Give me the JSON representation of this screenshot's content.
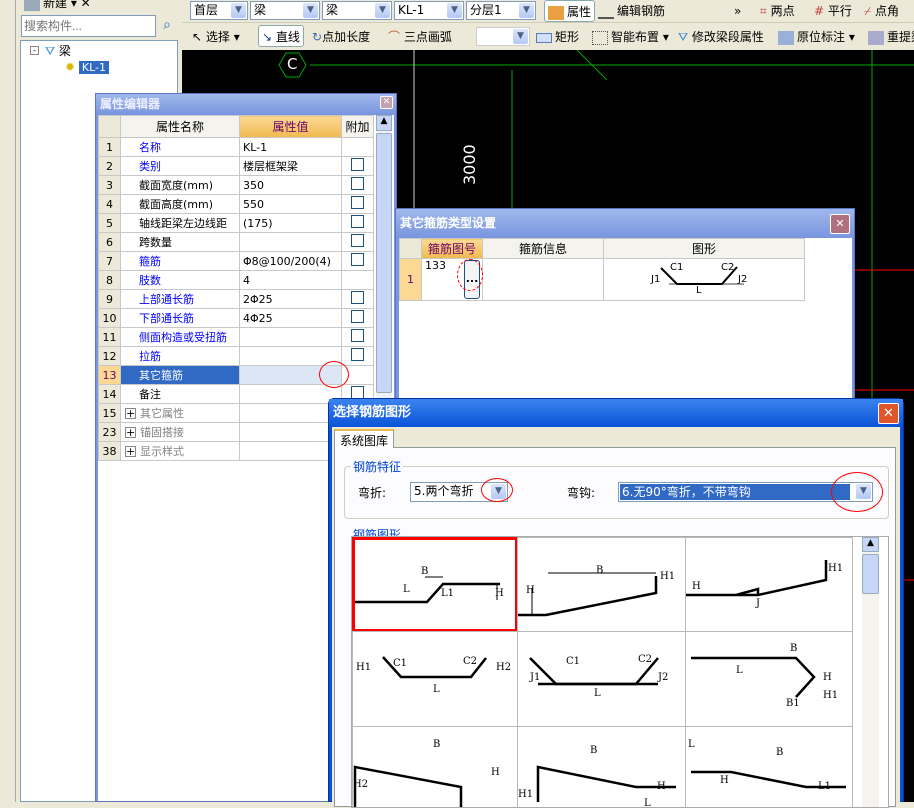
{
  "left_panel": {
    "new_label": "新建",
    "search_placeholder": "搜索构件...",
    "tree": {
      "root": "梁",
      "child": "KL-1"
    }
  },
  "toolbar1": {
    "floor": "首层",
    "type1": "梁",
    "type2": "梁",
    "component": "KL-1",
    "layer": "分层1",
    "props": "属性",
    "edit_rebar": "编辑钢筋",
    "more": "»",
    "two_point": "两点",
    "parallel": "平行",
    "point_angle": "点角"
  },
  "toolbar2": {
    "select": "选择",
    "line": "直线",
    "point_length": "点加长度",
    "arc": "三点画弧",
    "shape_combo": "",
    "rect": "矩形",
    "smart": "智能布置",
    "modify_span": "修改梁段属性",
    "in_situ": "原位标注",
    "re_extract": "重提梁"
  },
  "canvas": {
    "axis_label": "C",
    "dimension": "3000"
  },
  "prop_editor": {
    "title": "属性编辑器",
    "headers": [
      "属性名称",
      "属性值",
      "附加"
    ],
    "rows": [
      {
        "n": "1",
        "name": "名称",
        "value": "KL-1",
        "blue": true,
        "check": false
      },
      {
        "n": "2",
        "name": "类别",
        "value": "楼层框架梁",
        "blue": true,
        "check": true
      },
      {
        "n": "3",
        "name": "截面宽度(mm)",
        "value": "350",
        "blue": false,
        "check": true
      },
      {
        "n": "4",
        "name": "截面高度(mm)",
        "value": "550",
        "blue": false,
        "check": true
      },
      {
        "n": "5",
        "name": "轴线距梁左边线距",
        "value": "(175)",
        "blue": false,
        "check": true
      },
      {
        "n": "6",
        "name": "跨数量",
        "value": "",
        "blue": false,
        "check": true
      },
      {
        "n": "7",
        "name": "箍筋",
        "value": "Φ8@100/200(4)",
        "blue": true,
        "check": true
      },
      {
        "n": "8",
        "name": "肢数",
        "value": "4",
        "blue": true,
        "check": false
      },
      {
        "n": "9",
        "name": "上部通长筋",
        "value": "2Φ25",
        "blue": true,
        "check": true
      },
      {
        "n": "10",
        "name": "下部通长筋",
        "value": "4Φ25",
        "blue": true,
        "check": true
      },
      {
        "n": "11",
        "name": "侧面构造或受扭筋",
        "value": "",
        "blue": true,
        "check": true
      },
      {
        "n": "12",
        "name": "拉筋",
        "value": "",
        "blue": true,
        "check": true
      },
      {
        "n": "13",
        "name": "其它箍筋",
        "value": "",
        "blue": false,
        "check": false,
        "selected": true
      },
      {
        "n": "14",
        "name": "备注",
        "value": "",
        "blue": false,
        "check": true
      },
      {
        "n": "15",
        "name": "其它属性",
        "value": "",
        "group": true
      },
      {
        "n": "23",
        "name": "锚固搭接",
        "value": "",
        "group": true
      },
      {
        "n": "38",
        "name": "显示样式",
        "value": "",
        "group": true
      }
    ]
  },
  "stirrup_dialog": {
    "title": "其它箍筋类型设置",
    "headers": [
      "箍筋图号",
      "箍筋信息",
      "图形"
    ],
    "row": {
      "n": "1",
      "code": "133",
      "info": "",
      "button": "...",
      "labels": [
        "C1",
        "C2",
        "J1",
        "J2",
        "L"
      ]
    }
  },
  "shape_dialog": {
    "title": "选择钢筋图形",
    "tab": "系统图库",
    "group1": "钢筋特征",
    "bend_label": "弯折:",
    "bend_value": "5.两个弯折",
    "hook_label": "弯钩:",
    "hook_value": "6.无90°弯折，不带弯钩",
    "group2": "钢筋图形",
    "cells": [
      {
        "labels": [
          "B",
          "L",
          "L1",
          "H"
        ],
        "selected": true
      },
      {
        "labels": [
          "B",
          "H1",
          "H"
        ]
      },
      {
        "labels": [
          "H",
          "H1",
          "J"
        ]
      },
      {
        "labels": [
          "H1",
          "C1",
          "C2",
          "H2",
          "L"
        ]
      },
      {
        "labels": [
          "C1",
          "C2",
          "J1",
          "J2",
          "L"
        ]
      },
      {
        "labels": [
          "B",
          "L",
          "H",
          "H1",
          "B1"
        ]
      },
      {
        "labels": [
          "B",
          "H",
          "H2",
          "H1"
        ]
      },
      {
        "labels": [
          "B",
          "H",
          "H1",
          "L"
        ]
      },
      {
        "labels": [
          "L",
          "B",
          "H",
          "L1"
        ]
      }
    ]
  },
  "colors": {
    "title_blue": "#7a96df",
    "dialog_blue": "#0a53d8",
    "selected_row": "#316ac5",
    "highlight_red": "#ff0000"
  }
}
